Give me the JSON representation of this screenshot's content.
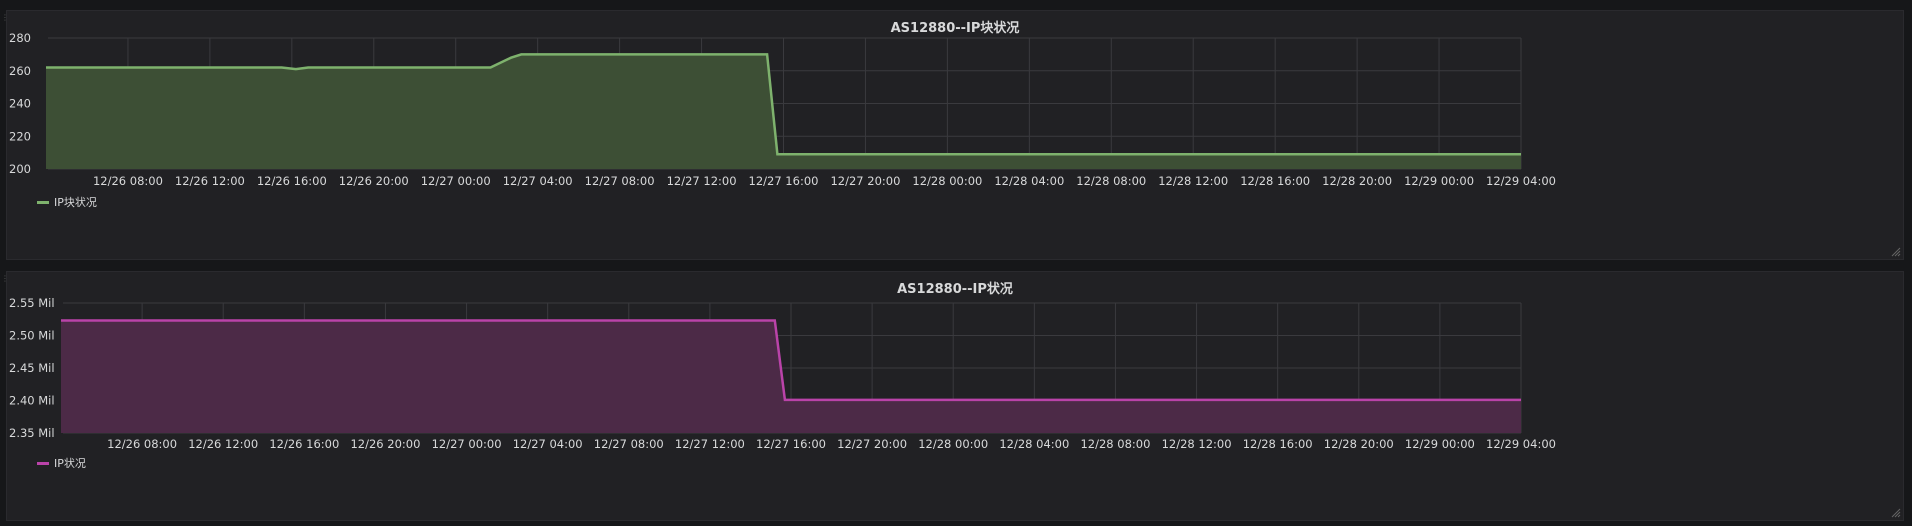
{
  "panels": [
    {
      "title": "AS12880--IP块状况",
      "legend_label": "IP块状况",
      "color": "#7eb26d",
      "fill": "#3d4f35",
      "chart_data": {
        "type": "area",
        "x_unit": "hours since 12/26 04:00 (approx.)",
        "xlim": [
          0,
          72
        ],
        "ylim": [
          200,
          280
        ],
        "yticks": [
          "200",
          "220",
          "240",
          "260",
          "280"
        ],
        "ytick_values": [
          200,
          220,
          240,
          260,
          280
        ],
        "xticks": [
          "12/26 08:00",
          "12/26 12:00",
          "12/26 16:00",
          "12/26 20:00",
          "12/27 00:00",
          "12/27 04:00",
          "12/27 08:00",
          "12/27 12:00",
          "12/27 16:00",
          "12/27 20:00",
          "12/28 00:00",
          "12/28 04:00",
          "12/28 08:00",
          "12/28 12:00",
          "12/28 16:00",
          "12/28 20:00",
          "12/29 00:00",
          "12/29 04:00"
        ],
        "xtick_values": [
          4,
          8,
          12,
          16,
          20,
          24,
          28,
          32,
          36,
          40,
          44,
          48,
          52,
          56,
          60,
          64,
          68,
          72
        ],
        "grid": true,
        "series": [
          {
            "name": "IP块状况",
            "x": [
              0,
              11.5,
              12.2,
              12.8,
              21.7,
              22.7,
              23.2,
              35.2,
              35.7,
              72
            ],
            "y": [
              262,
              262,
              261,
              262,
              262,
              268,
              270,
              270,
              209,
              209
            ]
          }
        ]
      }
    },
    {
      "title": "AS12880--IP状况",
      "legend_label": "IP状况",
      "color": "#ba43a9",
      "fill": "#4c2a47",
      "chart_data": {
        "type": "area",
        "x_unit": "hours since 12/26 04:00 (approx.)",
        "xlim": [
          0,
          72
        ],
        "ylim": [
          2.35,
          2.55
        ],
        "yticks": [
          "2.35 Mil",
          "2.40 Mil",
          "2.45 Mil",
          "2.50 Mil",
          "2.55 Mil"
        ],
        "ytick_values": [
          2.35,
          2.4,
          2.45,
          2.5,
          2.55
        ],
        "xticks": [
          "12/26 08:00",
          "12/26 12:00",
          "12/26 16:00",
          "12/26 20:00",
          "12/27 00:00",
          "12/27 04:00",
          "12/27 08:00",
          "12/27 12:00",
          "12/27 16:00",
          "12/27 20:00",
          "12/28 00:00",
          "12/28 04:00",
          "12/28 08:00",
          "12/28 12:00",
          "12/28 16:00",
          "12/28 20:00",
          "12/29 00:00",
          "12/29 04:00"
        ],
        "xtick_values": [
          4,
          8,
          12,
          16,
          20,
          24,
          28,
          32,
          36,
          40,
          44,
          48,
          52,
          56,
          60,
          64,
          68,
          72
        ],
        "grid": true,
        "series": [
          {
            "name": "IP状况",
            "x": [
              0,
              35.2,
              35.7,
              72
            ],
            "y": [
              2.523,
              2.523,
              2.401,
              2.401
            ]
          }
        ]
      }
    }
  ]
}
